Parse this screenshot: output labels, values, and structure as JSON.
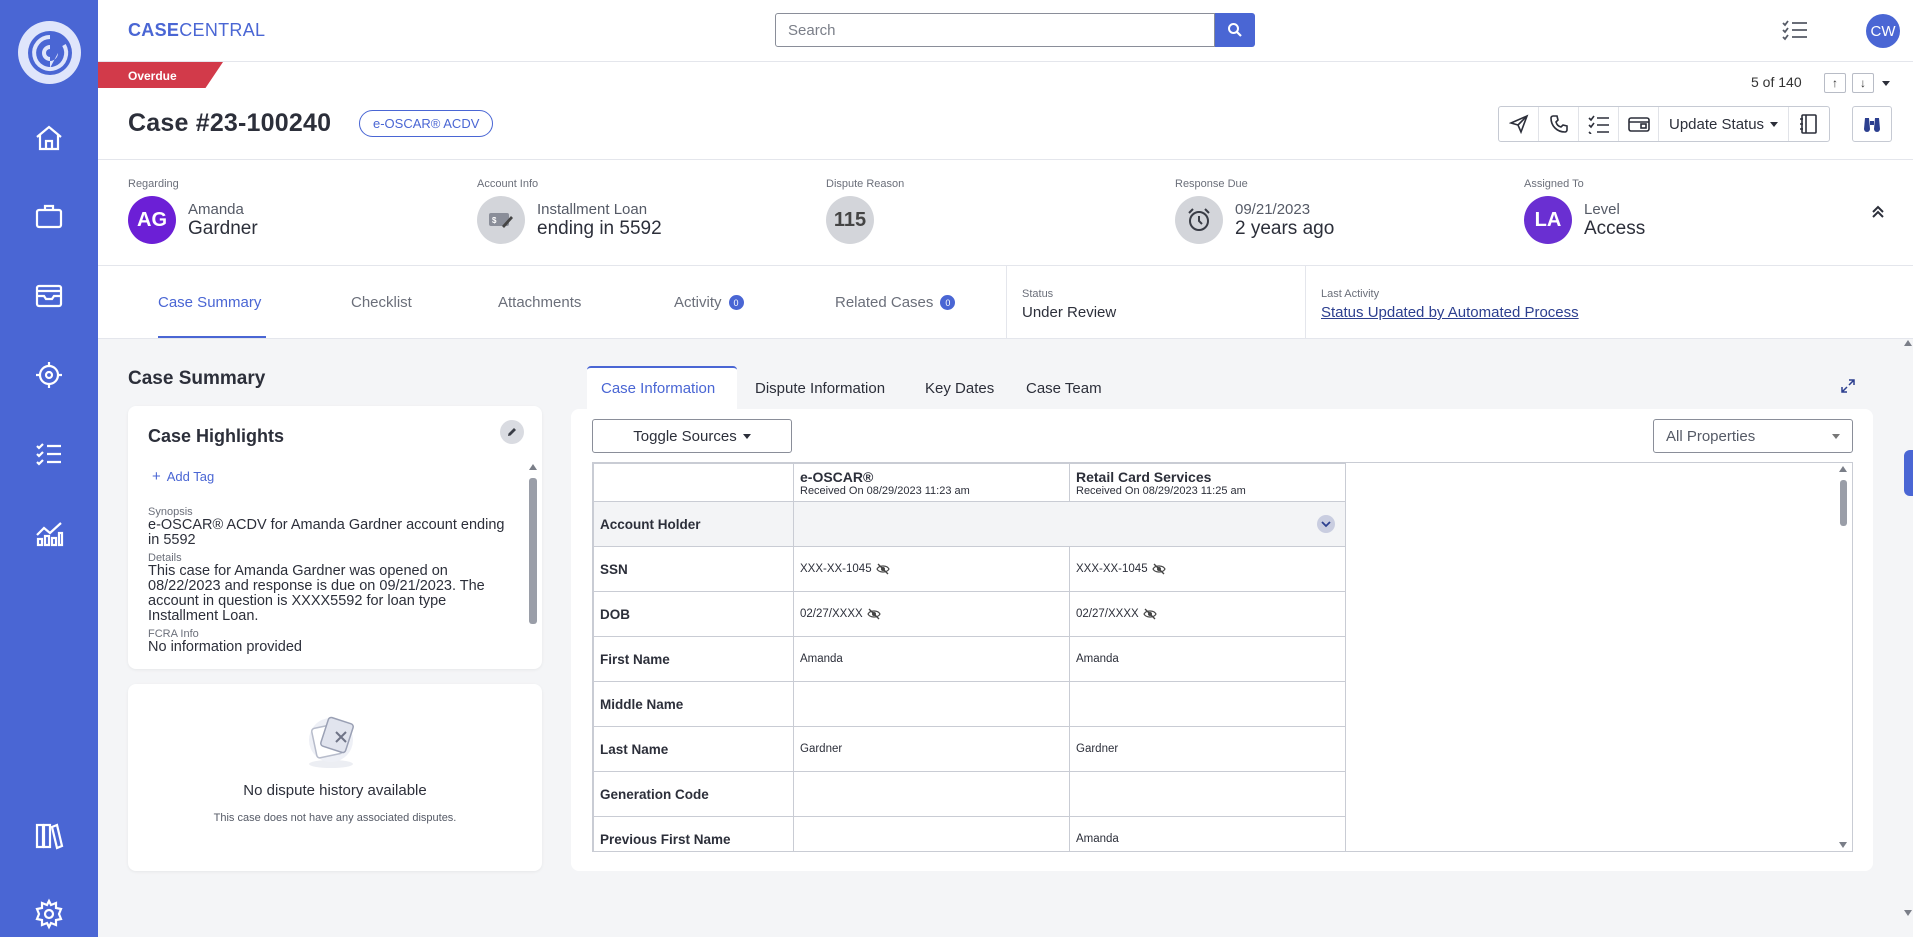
{
  "app": {
    "brand_bold": "CASE",
    "brand_thin": "CENTRAL",
    "user_initials": "CW"
  },
  "search": {
    "placeholder": "Search"
  },
  "case": {
    "overdue_label": "Overdue",
    "title": "Case #23-100240",
    "badge": "e-OSCAR® ACDV",
    "pager": "5 of 140",
    "toolbar": {
      "update_status": "Update Status"
    }
  },
  "info": {
    "regarding": {
      "label": "Regarding",
      "initials": "AG",
      "first": "Amanda",
      "last": "Gardner"
    },
    "account": {
      "label": "Account Info",
      "sub": "Installment Loan",
      "main": "ending in 5592"
    },
    "dispute": {
      "label": "Dispute Reason",
      "code": "115"
    },
    "response": {
      "label": "Response Due",
      "sub": "09/21/2023",
      "main": "2 years ago"
    },
    "assigned": {
      "label": "Assigned To",
      "initials": "LA",
      "sub": "Level",
      "main": "Access"
    }
  },
  "tabs": [
    {
      "label": "Case Summary"
    },
    {
      "label": "Checklist"
    },
    {
      "label": "Attachments"
    },
    {
      "label": "Activity",
      "count": "0"
    },
    {
      "label": "Related Cases",
      "count": "0"
    }
  ],
  "status_meta": {
    "label": "Status",
    "value": "Under Review"
  },
  "last_activity": {
    "label": "Last Activity",
    "value": "Status Updated by Automated Process"
  },
  "summary": {
    "heading": "Case Summary",
    "highlights_title": "Case Highlights",
    "add_tag": "Add Tag",
    "synopsis_label": "Synopsis",
    "synopsis": "e-OSCAR® ACDV for Amanda Gardner account ending in 5592",
    "details_label": "Details",
    "details": "This case for Amanda Gardner was opened on 08/22/2023 and response is due on 09/21/2023. The account in question is XXXX5592 for loan type Installment Loan.",
    "fcra_label": "FCRA Info",
    "fcra": "No information provided"
  },
  "no_disputes": {
    "title": "No dispute history available",
    "subtitle": "This case does not have any associated disputes."
  },
  "right_tabs": [
    {
      "label": "Case Information"
    },
    {
      "label": "Dispute Information"
    },
    {
      "label": "Key Dates"
    },
    {
      "label": "Case Team"
    }
  ],
  "controls": {
    "toggle_sources": "Toggle Sources",
    "all_properties": "All Properties"
  },
  "sources": [
    {
      "name": "e-OSCAR®",
      "received": "Received On 08/29/2023 11:23 am"
    },
    {
      "name": "Retail Card Services",
      "received": "Received On 08/29/2023 11:25 am"
    }
  ],
  "rows": [
    {
      "field": "Account Holder",
      "group": true,
      "v1": "",
      "v2": ""
    },
    {
      "field": "SSN",
      "v1": "XXX-XX-1045",
      "v2": "XXX-XX-1045",
      "masked": true
    },
    {
      "field": "DOB",
      "v1": "02/27/XXXX",
      "v2": "02/27/XXXX",
      "masked": true
    },
    {
      "field": "First Name",
      "v1": "Amanda",
      "v2": "Amanda"
    },
    {
      "field": "Middle Name",
      "v1": "",
      "v2": ""
    },
    {
      "field": "Last Name",
      "v1": "Gardner",
      "v2": "Gardner"
    },
    {
      "field": "Generation Code",
      "v1": "",
      "v2": ""
    },
    {
      "field": "Previous First Name",
      "v1": "",
      "v2": "Amanda"
    }
  ]
}
